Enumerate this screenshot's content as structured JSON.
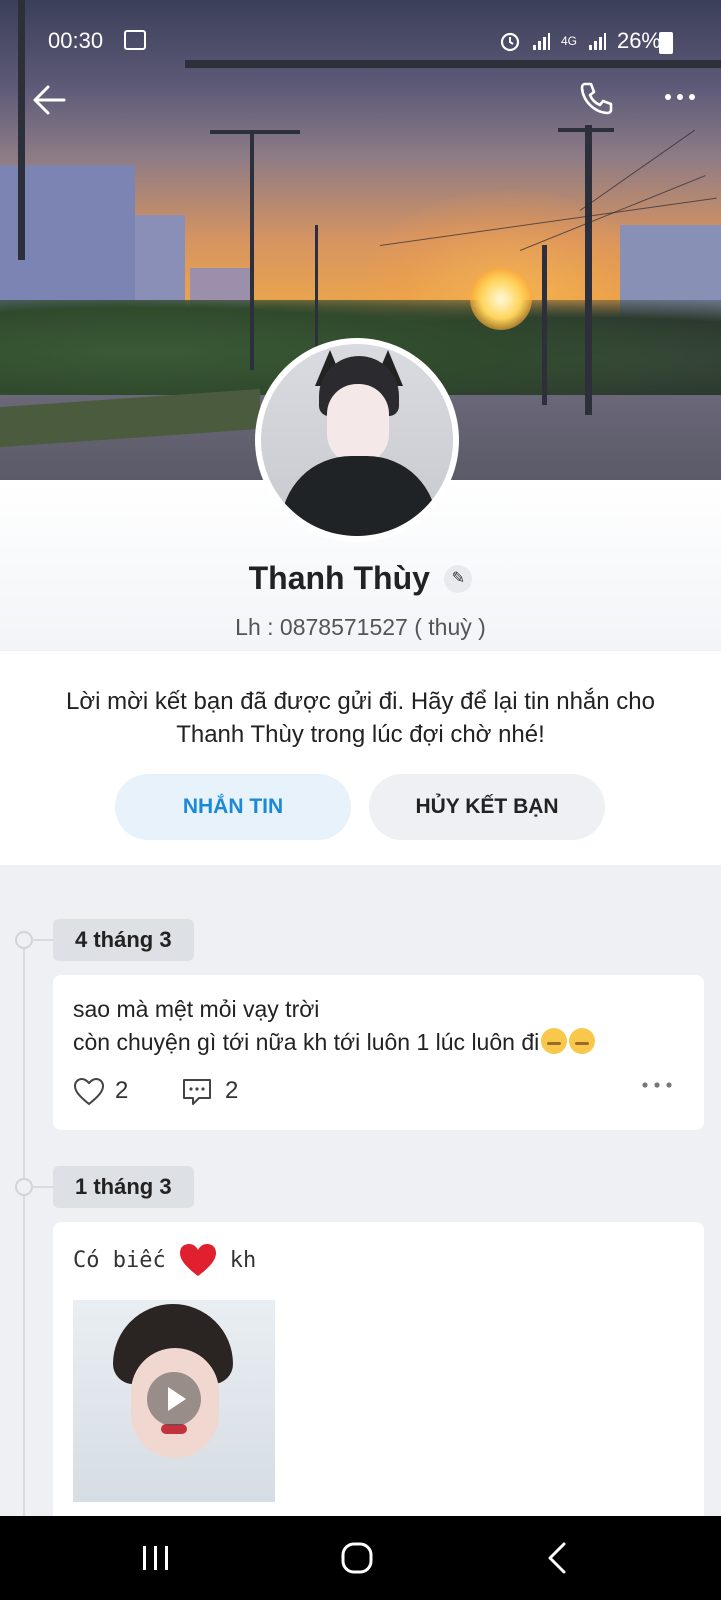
{
  "status_bar": {
    "time": "00:30",
    "network": "4G",
    "battery": "26%"
  },
  "profile": {
    "name": "Thanh Thùy",
    "bio": "Lh : 0878571527 ( thuỳ )"
  },
  "friend_request": {
    "message": "Lời mời kết bạn đã được gửi đi. Hãy để lại tin nhắn cho Thanh Thùy trong lúc đợi chờ nhé!",
    "message_button": "NHẮN TIN",
    "unfriend_button": "HỦY KẾT BẠN"
  },
  "timeline": [
    {
      "date": "4 tháng 3",
      "lines": [
        "sao mà mệt mỏi vạy trời",
        "còn chuyện gì tới nữa kh tới luôn 1 lúc luôn đi"
      ],
      "likes": "2",
      "comments": "2"
    },
    {
      "date": "1 tháng 3",
      "text_before": "Có biếc",
      "text_after": "kh"
    }
  ],
  "icons": {
    "back": "arrow-left-icon",
    "call": "phone-icon",
    "more": "more-icon",
    "edit": "pencil-icon",
    "like": "heart-outline-icon",
    "comment": "comment-icon",
    "heart": "red-heart-icon",
    "play": "play-icon"
  },
  "colors": {
    "accent": "#1a8ad8",
    "heart": "#e0202e",
    "nav_bar": "#000000"
  }
}
